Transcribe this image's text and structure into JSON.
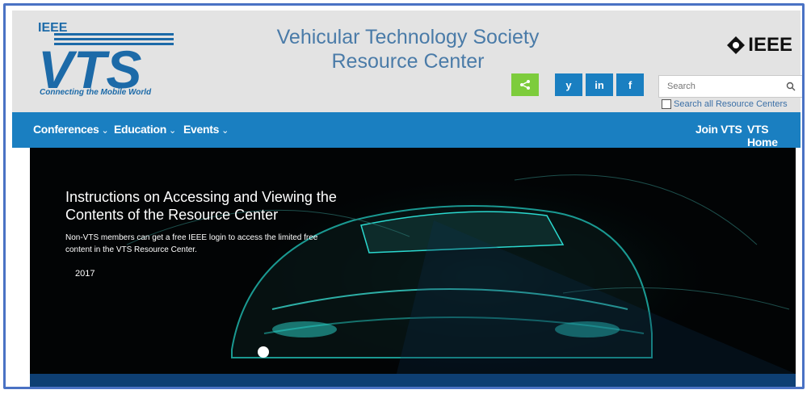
{
  "header": {
    "logo": {
      "org": "IEEE",
      "acronym": "VTS",
      "tagline": "Connecting the Mobile World"
    },
    "title_line1": "Vehicular Technology Society",
    "title_line2": "Resource Center",
    "ieee_brand": "IEEE",
    "social": [
      {
        "name": "share-icon",
        "label": "<"
      },
      {
        "name": "twitter-icon",
        "label": "y"
      },
      {
        "name": "linkedin-icon",
        "label": "in"
      },
      {
        "name": "facebook-icon",
        "label": "f"
      }
    ],
    "search": {
      "placeholder": "Search",
      "all_label": "Search all Resource Centers"
    }
  },
  "nav": {
    "left": [
      {
        "label": "Conferences"
      },
      {
        "label": "Education"
      },
      {
        "label": "Events"
      }
    ],
    "right": [
      {
        "label": "Join VTS"
      },
      {
        "label": "VTS Home"
      }
    ]
  },
  "hero": {
    "title_line1": "Instructions on Accessing and Viewing the",
    "title_line2": "Contents of the Resource Center",
    "text_line1": "Non-VTS members can get a free IEEE login to access the limited free",
    "text_line2": "content in the VTS Resource Center.",
    "year": "2017"
  },
  "colors": {
    "header_bg": "#e3e3e3",
    "nav_bg": "#1a7fc1",
    "title_color": "#4a7ba8",
    "share_bg": "#7dcc3c"
  }
}
